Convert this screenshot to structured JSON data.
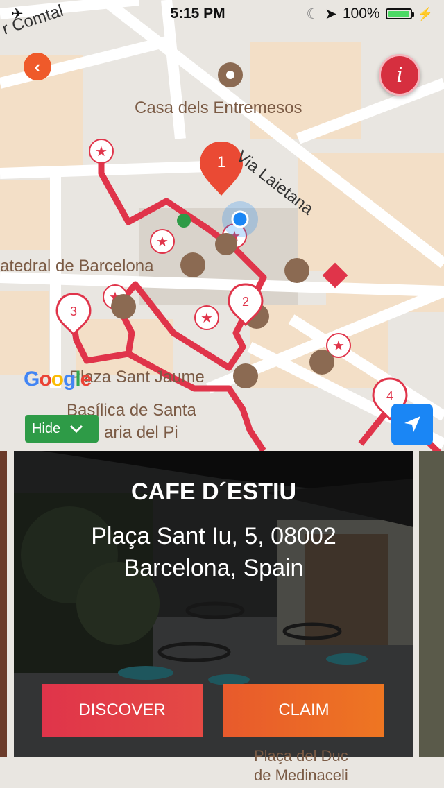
{
  "status_bar": {
    "time": "5:15 PM",
    "battery": "100%"
  },
  "map": {
    "labels": {
      "comtal": "r Comtal",
      "entremesos": "Casa dels Entremesos",
      "laietana": "Via Laietana",
      "catedral": "atedral de Barcelona",
      "placa_jaume": "Plaza Sant Jaume",
      "basilica_line1": "Basílica de Santa",
      "basilica_line2": "aria del Pi",
      "medinaceli_line1": "Plaça del Duc",
      "medinaceli_line2": "de Medinaceli"
    },
    "pins": [
      "1",
      "2",
      "3",
      "4"
    ],
    "google": [
      "G",
      "o",
      "o",
      "g",
      "l",
      "e"
    ]
  },
  "controls": {
    "back": "‹",
    "info": "i",
    "hide_label": "Hide"
  },
  "card": {
    "title": "CAFE D´ESTIU",
    "address_line1": "Plaça Sant Iu, 5, 08002",
    "address_line2": "Barcelona, Spain",
    "discover_label": "DISCOVER",
    "claim_label": "CLAIM"
  },
  "colors": {
    "route": "#e0344a",
    "accent": "#ef5a2a",
    "locate": "#1a86f5",
    "hide": "#2e9b47"
  }
}
